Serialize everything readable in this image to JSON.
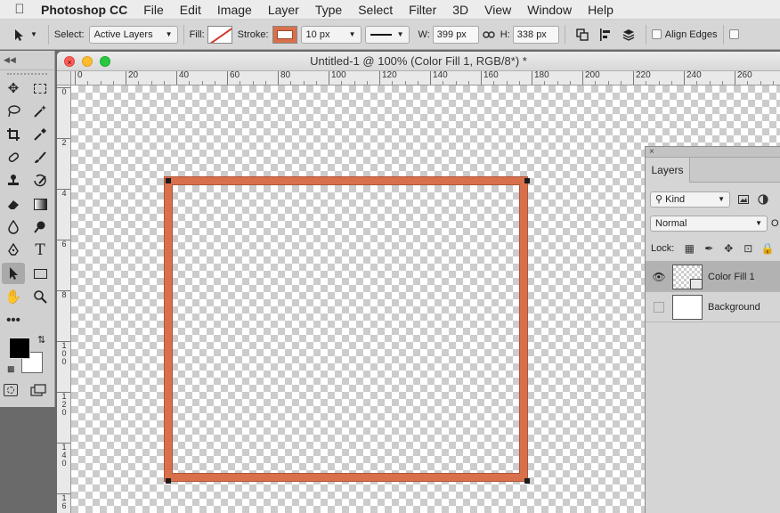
{
  "menubar": {
    "app_name": "Photoshop CC",
    "items": [
      "File",
      "Edit",
      "Image",
      "Layer",
      "Type",
      "Select",
      "Filter",
      "3D",
      "View",
      "Window",
      "Help"
    ]
  },
  "options_bar": {
    "select_label": "Select:",
    "select_value": "Active Layers",
    "fill_label": "Fill:",
    "stroke_label": "Stroke:",
    "stroke_width": "10 px",
    "w_label": "W:",
    "w_value": "399 px",
    "h_label": "H:",
    "h_value": "338 px",
    "align_edges_label": "Align Edges"
  },
  "document": {
    "title": "Untitled-1 @ 100% (Color Fill 1, RGB/8*) *",
    "ruler_h": [
      "0",
      "20",
      "40",
      "60",
      "80",
      "100",
      "120",
      "140",
      "160",
      "180",
      "200",
      "220",
      "240",
      "260"
    ],
    "ruler_v": [
      [
        "0"
      ],
      [
        "2"
      ],
      [
        "4"
      ],
      [
        "6"
      ],
      [
        "8"
      ],
      [
        "1",
        "0",
        "0"
      ],
      [
        "1",
        "2",
        "0"
      ],
      [
        "1",
        "4",
        "0"
      ],
      [
        "1",
        "6"
      ]
    ],
    "shape_stroke_color": "#d9704c"
  },
  "layers_panel": {
    "tab_label": "Layers",
    "kind_label": "Kind",
    "blend_mode": "Normal",
    "opacity_cut": "O",
    "lock_label": "Lock:",
    "layers": [
      {
        "name": "Color Fill 1",
        "visible": true,
        "selected": true
      },
      {
        "name": "Background",
        "visible": false,
        "selected": false
      }
    ]
  }
}
